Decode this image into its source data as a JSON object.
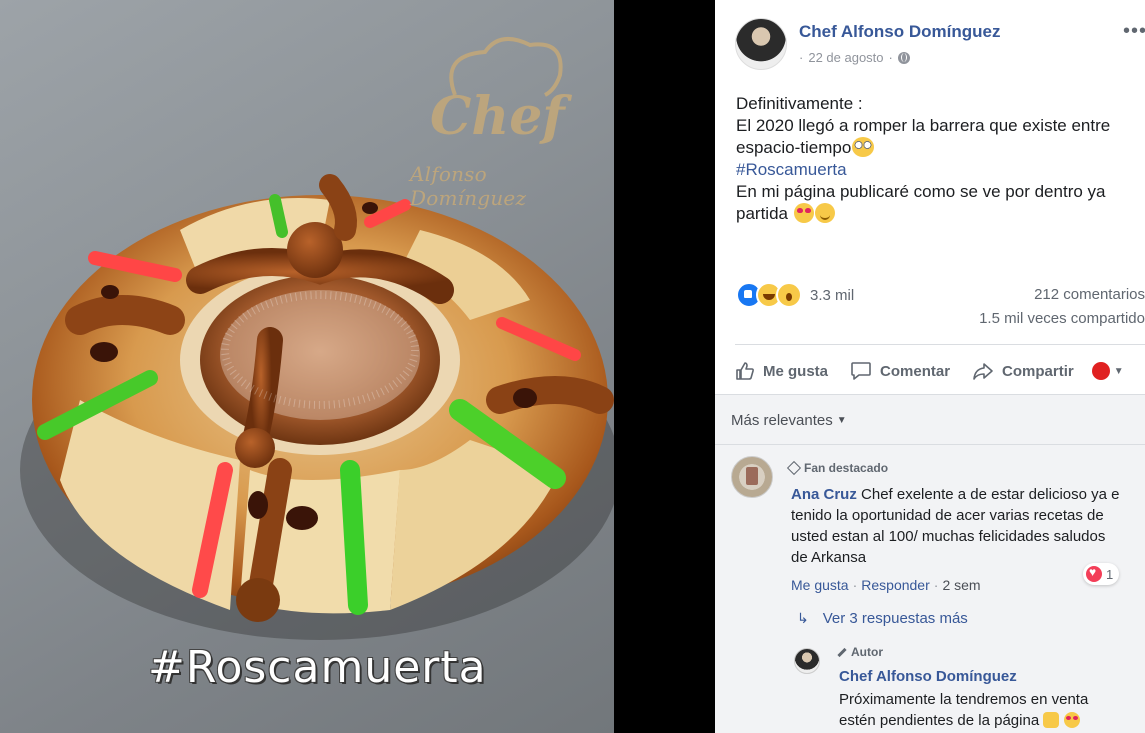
{
  "photo": {
    "watermark_chef": "Chef",
    "watermark_name": "Alfonso Domínguez",
    "caption": "#Roscamuerta"
  },
  "post": {
    "author": "Chef Alfonso Domínguez",
    "date": "22 de agosto",
    "more": "•••",
    "text_line1": "Definitivamente :",
    "text_line2": "El 2020 llegó a romper la barrera que existe entre",
    "text_line3": "espacio-tiempo",
    "hashtag": "#Roscamuerta",
    "text_line5": "En mi página publicaré como se ve por dentro ya",
    "text_line6": "partida",
    "reaction_count": "3.3 mil",
    "comments_count": "212 comentarios",
    "shares_count": "1.5 mil veces compartido",
    "reaction_icons": [
      "like-icon",
      "haha-icon",
      "wow-icon"
    ]
  },
  "actions": {
    "like": "Me gusta",
    "comment": "Comentar",
    "share": "Compartir"
  },
  "comments": {
    "sort_label": "Más relevantes",
    "first": {
      "badge": "Fan destacado",
      "author": "Ana Cruz",
      "text": "Chef exelente a de estar delicioso ya e tenido la oportunidad de acer varias recetas de usted estan al 100/ muchas felicidades saludos de Arkansa",
      "like_label": "Me gusta",
      "reply_label": "Responder",
      "time": "2 sem",
      "reaction_count": "1"
    },
    "more_replies": "Ver 3 respuestas más",
    "reply": {
      "badge": "Autor",
      "author": "Chef Alfonso Domínguez",
      "text": "Próximamente la tendremos en venta estén pendientes de la página"
    }
  },
  "colors": {
    "link": "#385898",
    "secondary_text": "#606770",
    "like_blue": "#1877f2",
    "love_red": "#f33e58"
  }
}
